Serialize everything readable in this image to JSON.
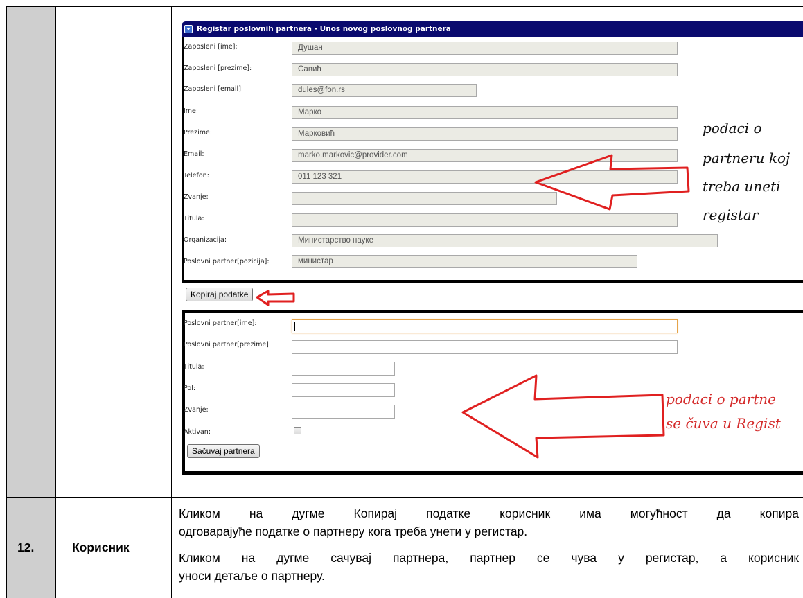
{
  "window": {
    "title": "Registar poslovnih partnera - Unos novog poslovnog partnera",
    "title_icon": "chevron-down-icon"
  },
  "employee_form": {
    "fields": [
      {
        "label": "Zaposleni [ime]:",
        "value": "Душан"
      },
      {
        "label": "Zaposleni [prezime]:",
        "value": "Савић"
      },
      {
        "label": "Zaposleni [email]:",
        "value": "dules@fon.rs"
      },
      {
        "label": "Ime:",
        "value": "Марко"
      },
      {
        "label": "Prezime:",
        "value": "Марковић"
      },
      {
        "label": "Email:",
        "value": "marko.markovic@provider.com"
      },
      {
        "label": "Telefon:",
        "value": "011 123 321"
      },
      {
        "label": "Zvanje:",
        "value": ""
      },
      {
        "label": "Titula:",
        "value": ""
      },
      {
        "label": "Organizacija:",
        "value": "Министарство науке"
      },
      {
        "label": "Poslovni partner[pozicija]:",
        "value": "министар"
      }
    ],
    "copy_button": "Kopiraj podatke"
  },
  "partner_form": {
    "fields": [
      {
        "label": "Poslovni partner[ime]:",
        "value": ""
      },
      {
        "label": "Poslovni partner[prezime]:",
        "value": ""
      },
      {
        "label": "Titula:",
        "value": ""
      },
      {
        "label": "Pol:",
        "value": ""
      },
      {
        "label": "Zvanje:",
        "value": ""
      },
      {
        "label": "Aktivan:",
        "value": ""
      }
    ],
    "save_button": "Sačuvaj partnera"
  },
  "annotations": {
    "note1": [
      "podaci o",
      "partneru koj",
      "treba uneti",
      "registar"
    ],
    "note2": [
      "podaci o partne",
      "se čuva u Regist"
    ],
    "note1_color": "#111111",
    "note2_color": "#d42a2a",
    "arrow_color": "#e02020"
  },
  "row12": {
    "number": "12.",
    "actor": "Корисник",
    "paragraph1_line1": "Кликом на дугме Копирај податке корисник има могућност да копира",
    "paragraph1_line2": "одговарајуће податке о партнеру кога треба унети у регистар.",
    "paragraph2_line1": "Кликом на дугме сачувај партнера, партнер се чува у регистар, а корисник",
    "paragraph2_line2": "уноси детаље о партнеру."
  }
}
